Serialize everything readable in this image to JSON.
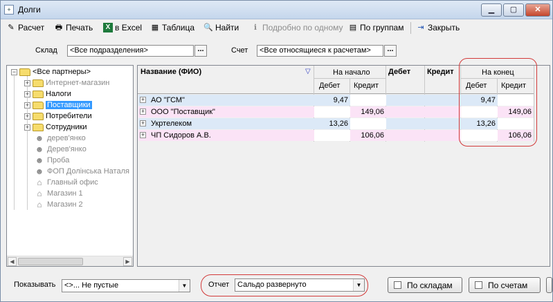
{
  "window": {
    "title": "Долги"
  },
  "toolbar": {
    "items": [
      {
        "label": "Расчет",
        "icon": "calc-icon",
        "glyph": "✎"
      },
      {
        "label": "Печать",
        "icon": "printer-icon",
        "glyph": "🖶"
      },
      {
        "label": "в Excel",
        "icon": "excel-icon",
        "glyph": "X"
      },
      {
        "label": "Таблица",
        "icon": "table-icon",
        "glyph": "▦"
      },
      {
        "label": "Найти",
        "icon": "search-icon",
        "glyph": "🔍"
      },
      {
        "label": "Подробно по одному",
        "icon": "info-icon",
        "glyph": "ℹ"
      },
      {
        "label": "По группам",
        "icon": "groups-icon",
        "glyph": "▤"
      },
      {
        "label": "Закрыть",
        "icon": "exit-icon",
        "glyph": "⇥"
      }
    ]
  },
  "filters": {
    "sklad_label": "Склад",
    "sklad_value": "<Все подразделения>",
    "schet_label": "Счет",
    "schet_value": "<Все относящиеся к расчетам>",
    "dots": "..."
  },
  "tree": {
    "root": "<Все партнеры>",
    "items": [
      {
        "label": "Интернет-магазин",
        "type": "folder",
        "gray": true
      },
      {
        "label": "Налоги",
        "type": "folder",
        "gray": false
      },
      {
        "label": "Поставщики",
        "type": "folder",
        "gray": false,
        "selected": true
      },
      {
        "label": "Потребители",
        "type": "folder",
        "gray": false
      },
      {
        "label": "Сотрудники",
        "type": "folder",
        "gray": false
      },
      {
        "label": "дерев'янко",
        "type": "person",
        "gray": true
      },
      {
        "label": "Дерев'янко",
        "type": "person",
        "gray": true
      },
      {
        "label": "Проба",
        "type": "person",
        "gray": true
      },
      {
        "label": "ФОП Долінська Наталя",
        "type": "person",
        "gray": true
      },
      {
        "label": "Главный офис",
        "type": "house",
        "gray": true
      },
      {
        "label": "Магазин 1",
        "type": "house",
        "gray": true
      },
      {
        "label": "Магазин 2",
        "type": "house",
        "gray": true
      }
    ]
  },
  "grid": {
    "headers": {
      "name": "Название (ФИО)",
      "start": "На начало",
      "debet": "Дебет",
      "kredit": "Кредит",
      "end": "На конец",
      "sub_debet": "Дебет",
      "sub_kredit": "Кредит"
    },
    "rows": [
      {
        "name": "АО \"ГСМ\"",
        "start_debet": "9,47",
        "start_kredit": "",
        "end_debet": "9,47",
        "end_kredit": "",
        "style": "blue"
      },
      {
        "name": "ООО \"Поставщик\"",
        "start_debet": "",
        "start_kredit": "149,06",
        "end_debet": "",
        "end_kredit": "149,06",
        "style": "pink"
      },
      {
        "name": "Укртелеком",
        "start_debet": "13,26",
        "start_kredit": "",
        "end_debet": "13,26",
        "end_kredit": "",
        "style": "blue"
      },
      {
        "name": "ЧП Сидоров А.В.",
        "start_debet": "",
        "start_kredit": "106,06",
        "end_debet": "",
        "end_kredit": "106,06",
        "style": "pink"
      }
    ]
  },
  "bottom": {
    "show_label": "Показывать",
    "show_value": "<>...  Не пустые",
    "report_label": "Отчет",
    "report_value": "Сальдо развернуто",
    "by_warehouses": "По складам",
    "by_accounts": "По счетам"
  }
}
